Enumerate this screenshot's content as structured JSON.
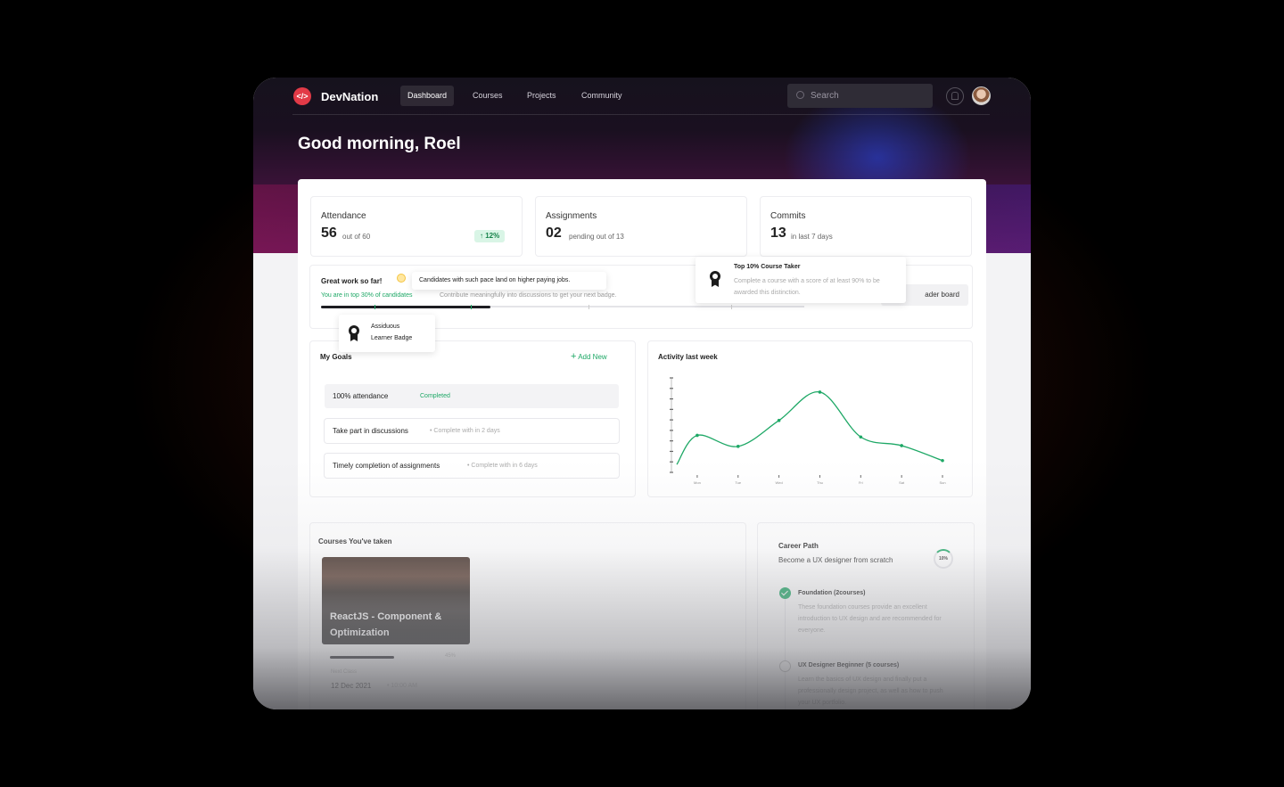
{
  "app": {
    "brand": "DevNation",
    "logo_glyph": "</>",
    "accent_color": "#e23a47",
    "success_color": "#1ea866"
  },
  "nav": {
    "items": [
      {
        "label": "Dashboard",
        "active": true
      },
      {
        "label": "Courses",
        "active": false
      },
      {
        "label": "Projects",
        "active": false
      },
      {
        "label": "Community",
        "active": false
      }
    ],
    "search_placeholder": "Search",
    "bell_icon": "bell-icon",
    "avatar_icon": "user-avatar"
  },
  "greeting": "Good morning, Roel",
  "stats": [
    {
      "label": "Attendance",
      "value": "56",
      "sub": "out of 60",
      "delta": "↑ 12%"
    },
    {
      "label": "Assignments",
      "value": "02",
      "sub": "pending out of 13"
    },
    {
      "label": "Commits",
      "value": "13",
      "sub": "in last 7 days"
    }
  ],
  "progress": {
    "title": "Great work so far!",
    "tip": "Candidates with such pace land on higher paying jobs.",
    "subtitle": "You are in top 30% of candidates",
    "subtitle2": "Contribute meaningfully into discussions to get your next badge.",
    "fill_percent": 35,
    "leaderboard_label": "ader board",
    "badge1_line1": "Assiduous",
    "badge1_line2": "Learner Badge",
    "badge2_title": "Top 10% Course Taker",
    "badge2_desc": "Complete a course with a score of at least 90% to be awarded this distinction."
  },
  "goals": {
    "title": "My Goals",
    "add_label": "Add New",
    "items": [
      {
        "name": "100% attendance",
        "status": "Completed"
      },
      {
        "name": "Take part in discussions",
        "status": "Complete with in 2 days"
      },
      {
        "name": "Timely completion of assignments",
        "status": "Complete with in 6 days"
      }
    ]
  },
  "activity": {
    "title": "Activity last week"
  },
  "chart_data": {
    "type": "line",
    "title": "Activity last week",
    "categories": [
      "Mon",
      "Tue",
      "Wed",
      "Thu",
      "Fri",
      "Sat",
      "Sun"
    ],
    "x": [
      0,
      0.5,
      1.5,
      2.5,
      3.5,
      4.5,
      5.5,
      6.5
    ],
    "values": [
      1,
      4.7,
      3.3,
      6.6,
      10.2,
      4.5,
      3.4,
      1.5
    ],
    "ylim": [
      0,
      12
    ],
    "ytick_count": 10,
    "ylabel": "",
    "xlabel": "",
    "line_color": "#1ea866",
    "grid": false
  },
  "courses": {
    "title": "Courses You've taken",
    "course_name": "ReactJS - Component & Optimization",
    "progress": 0.45,
    "percent_label": "45%",
    "next_label": "Next Class",
    "next_date": "12 Dec 2021",
    "next_extra": "• 10:00 AM"
  },
  "career": {
    "title": "Career Path",
    "subtitle": "Become a UX designer from scratch",
    "percent": "10%",
    "steps": [
      {
        "title": "Foundation (2courses)",
        "desc": "These foundation courses provide an excellent introduction to UX design and are recommended for everyone."
      },
      {
        "title": "UX Designer Beginner (5 courses)",
        "desc": "Learn the basics of UX design and finally put a professionally design project, as well as how to push your UX portfolio."
      }
    ]
  }
}
